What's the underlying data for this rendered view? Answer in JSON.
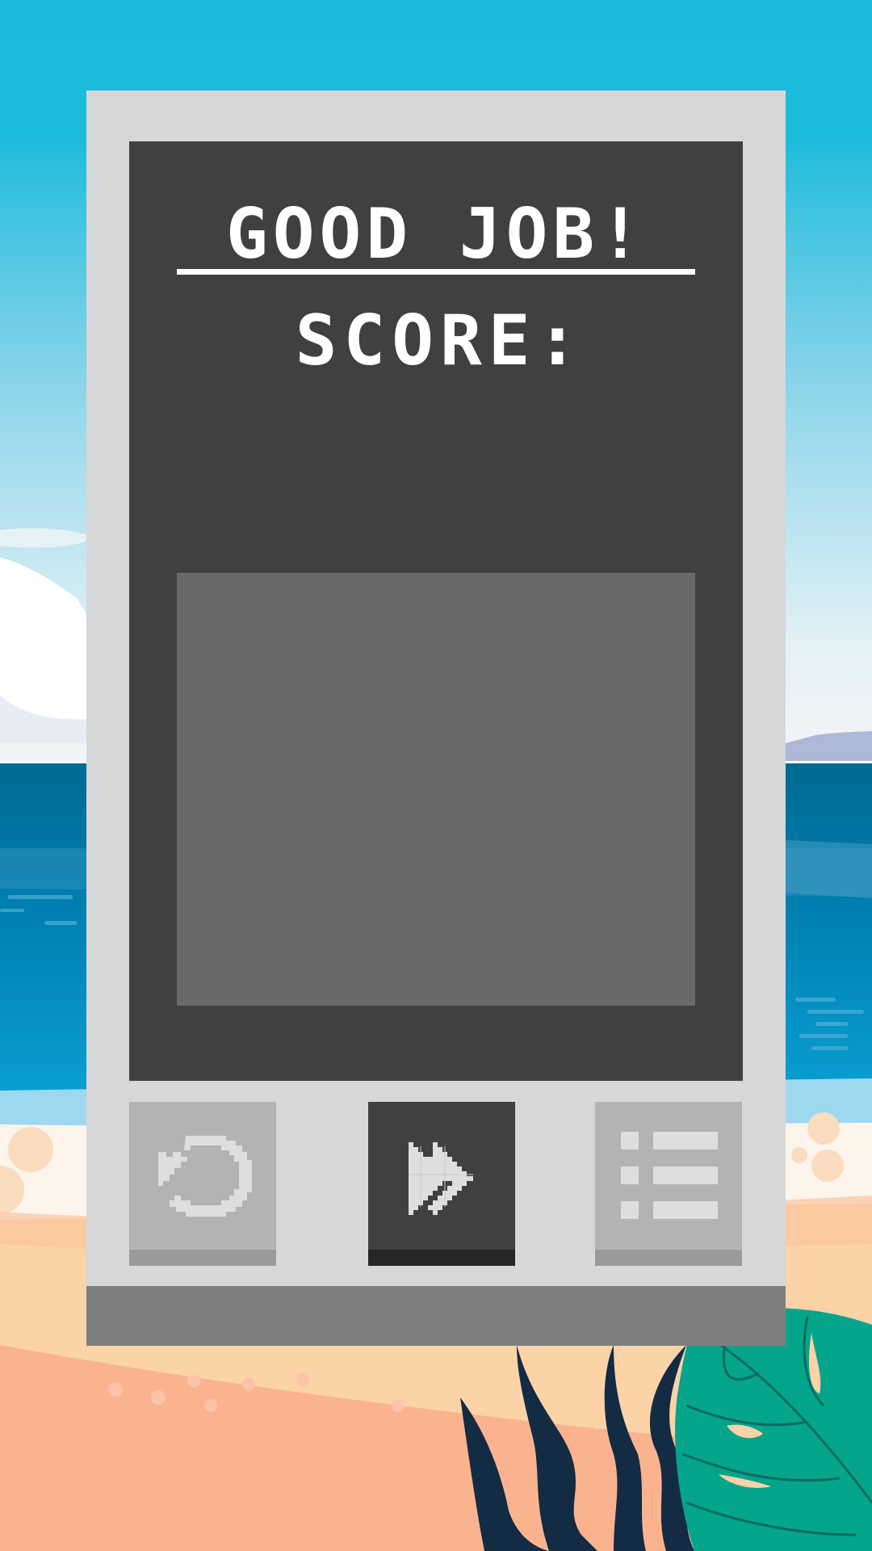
{
  "game_over": {
    "title": "GOOD JOB!",
    "score_label": "SCORE:",
    "score_value": ""
  },
  "buttons": {
    "restart": {
      "icon": "restart-icon"
    },
    "next": {
      "icon": "fast-forward-icon"
    },
    "menu": {
      "icon": "list-menu-icon"
    }
  },
  "colors": {
    "panel": "#d6d7d9",
    "screen": "#3f4040",
    "preview": "#696968",
    "panel_footer": "#7e7f7e",
    "text": "#ffffff",
    "sky_top": "#1bbadb",
    "sea": "#0079a8",
    "sand": "#fbb38f",
    "leaf": "#04a58a",
    "seaweed": "#132b43"
  }
}
